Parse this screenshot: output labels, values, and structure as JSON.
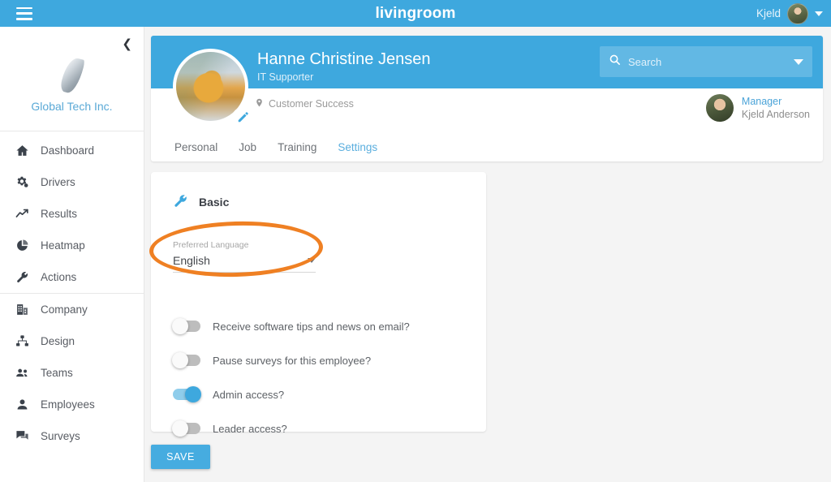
{
  "topbar": {
    "menu_icon": "hamburger-icon",
    "brand": "livingroom",
    "user_name": "Kjeld",
    "user_avatar": "avatar",
    "dropdown_icon": "chevron-down-icon"
  },
  "sidebar": {
    "collapse_icon": "chevron-left-icon",
    "company_logo": "feather-logo",
    "company_name": "Global Tech Inc.",
    "items": [
      {
        "label": "Dashboard",
        "icon": "home-icon"
      },
      {
        "label": "Drivers",
        "icon": "gears-icon"
      },
      {
        "label": "Results",
        "icon": "trend-line-icon"
      },
      {
        "label": "Heatmap",
        "icon": "pie-chart-icon"
      },
      {
        "label": "Actions",
        "icon": "wrench-icon"
      },
      {
        "label": "Company",
        "icon": "building-icon"
      },
      {
        "label": "Design",
        "icon": "sitemap-icon"
      },
      {
        "label": "Teams",
        "icon": "users-icon"
      },
      {
        "label": "Employees",
        "icon": "user-icon"
      },
      {
        "label": "Surveys",
        "icon": "comments-icon"
      }
    ]
  },
  "profile": {
    "name": "Hanne Christine Jensen",
    "title": "IT Supporter",
    "location": "Customer Success",
    "location_icon": "map-pin-icon",
    "photo": "employee-photo",
    "edit_icon": "pencil-icon",
    "manager": {
      "role_label": "Manager",
      "name": "Kjeld Anderson",
      "avatar": "manager-avatar"
    },
    "tabs": [
      {
        "label": "Personal",
        "active": false
      },
      {
        "label": "Job",
        "active": false
      },
      {
        "label": "Training",
        "active": false
      },
      {
        "label": "Settings",
        "active": true
      }
    ]
  },
  "search": {
    "icon": "search-icon",
    "placeholder": "Search",
    "value": "",
    "dropdown_icon": "caret-down-icon"
  },
  "settings": {
    "card_title": "Basic",
    "card_icon": "wrench-icon",
    "language_field": {
      "label": "Preferred Language",
      "value": "English",
      "dropdown_icon": "caret-down-icon",
      "highlight_color": "#ef8023",
      "highlighted": true
    },
    "toggles": [
      {
        "label": "Receive software tips and news on email?",
        "on": false
      },
      {
        "label": "Pause surveys for this employee?",
        "on": false
      },
      {
        "label": "Admin access?",
        "on": true
      },
      {
        "label": "Leader access?",
        "on": false
      }
    ],
    "save_label": "SAVE"
  },
  "colors": {
    "primary_blue": "#3ea8de",
    "accent_orange": "#ef8023",
    "link_blue": "#4aa3d8",
    "page_bg": "#f4f4f4"
  }
}
